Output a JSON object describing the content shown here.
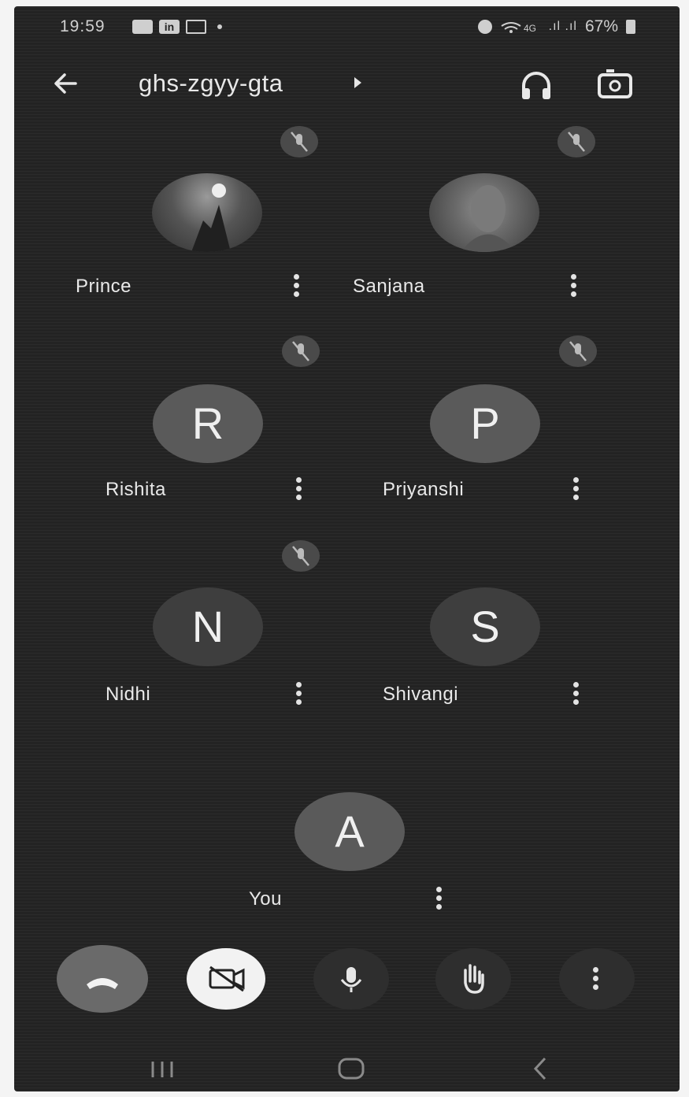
{
  "status_bar": {
    "time": "19:59",
    "battery": "67%",
    "signal_text": ".ıl .ıl"
  },
  "header": {
    "meeting_code": "ghs-zgyy-gta"
  },
  "participants": [
    {
      "name": "Prince",
      "initial": "",
      "has_photo": true,
      "muted": true
    },
    {
      "name": "Sanjana",
      "initial": "",
      "has_photo": true,
      "muted": true
    },
    {
      "name": "Rishita",
      "initial": "R",
      "has_photo": false,
      "muted": true
    },
    {
      "name": "Priyanshi",
      "initial": "P",
      "has_photo": false,
      "muted": true
    },
    {
      "name": "Nidhi",
      "initial": "N",
      "has_photo": false,
      "muted": true
    },
    {
      "name": "Shivangi",
      "initial": "S",
      "has_photo": false,
      "muted": false
    }
  ],
  "self": {
    "name": "You",
    "initial": "A"
  },
  "controls": {
    "end_call_icon": "phone-hangup-icon",
    "camera_icon": "camera-off-icon",
    "mic_icon": "mic-icon",
    "raise_hand_icon": "hand-icon",
    "more_icon": "more-vert-icon"
  }
}
